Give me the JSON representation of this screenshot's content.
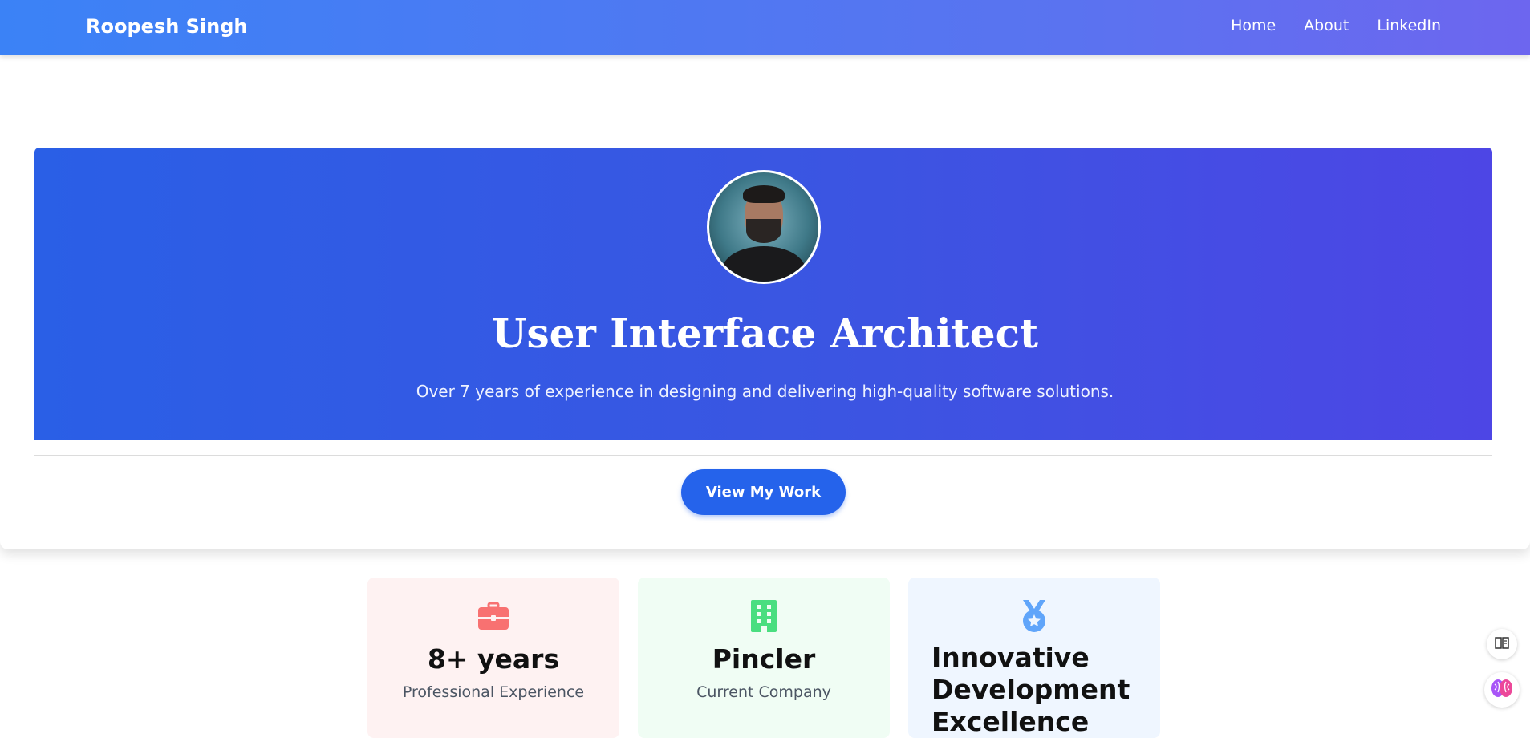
{
  "nav": {
    "brand": "Roopesh Singh",
    "links": [
      "Home",
      "About",
      "LinkedIn"
    ]
  },
  "hero": {
    "title": "User Interface Architect",
    "subtitle": "Over 7 years of experience in designing and delivering high-quality software solutions.",
    "cta_label": "View My Work"
  },
  "stats": [
    {
      "icon": "briefcase-icon",
      "value": "8+ years",
      "label": "Professional Experience",
      "bg": "#fef2f2",
      "icon_color": "#f87171"
    },
    {
      "icon": "building-icon",
      "value": "Pincler",
      "label": "Current Company",
      "bg": "#f0fdf4",
      "icon_color": "#4ade80"
    },
    {
      "icon": "medal-icon",
      "value": "Innovative Development Excellence",
      "label": "",
      "bg": "#eff6ff",
      "icon_color": "#60a5fa"
    }
  ],
  "colors": {
    "accent": "#2563eb",
    "hero_gradient_start": "#2a5fe6",
    "hero_gradient_end": "#4d46e5"
  },
  "floating": [
    "book-reader-icon",
    "brain-icon"
  ]
}
